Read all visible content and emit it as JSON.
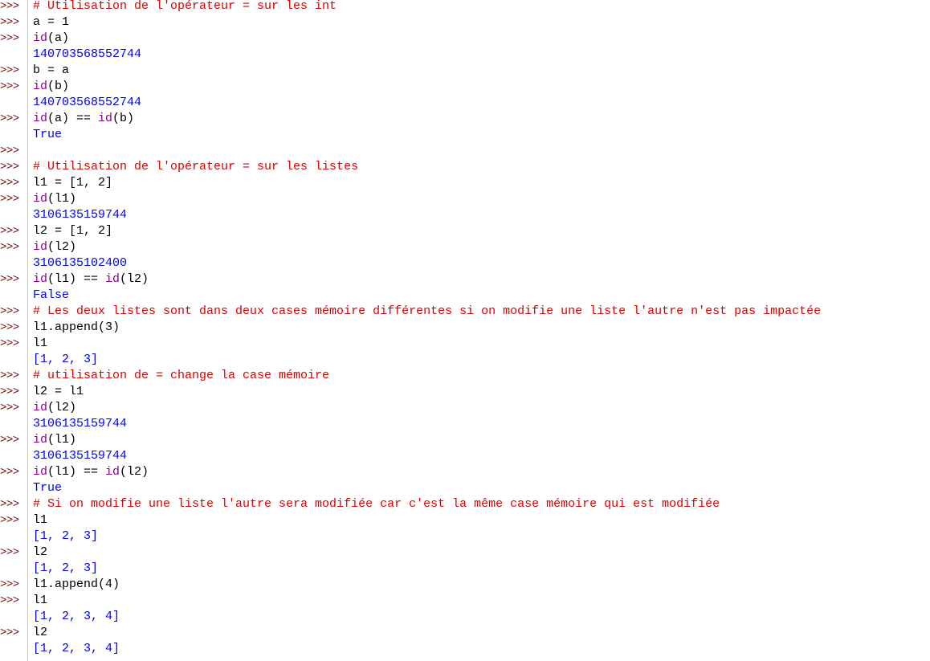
{
  "prompt_symbol": ">>>",
  "colors": {
    "plain": "#000000",
    "comment": "#dd0000",
    "builtin": "#900090",
    "output": "#0000ff",
    "prompt": "#770000"
  },
  "lines": [
    {
      "prompt": true,
      "segments": [
        {
          "t": "# Utilisation de l'opérateur = sur les int",
          "c": "comment"
        }
      ]
    },
    {
      "prompt": true,
      "segments": [
        {
          "t": "a = 1",
          "c": "plain"
        }
      ]
    },
    {
      "prompt": true,
      "segments": [
        {
          "t": "id",
          "c": "builtin"
        },
        {
          "t": "(a)",
          "c": "plain"
        }
      ]
    },
    {
      "prompt": false,
      "segments": [
        {
          "t": "140703568552744",
          "c": "output"
        }
      ]
    },
    {
      "prompt": true,
      "segments": [
        {
          "t": "b = a",
          "c": "plain"
        }
      ]
    },
    {
      "prompt": true,
      "segments": [
        {
          "t": "id",
          "c": "builtin"
        },
        {
          "t": "(b)",
          "c": "plain"
        }
      ]
    },
    {
      "prompt": false,
      "segments": [
        {
          "t": "140703568552744",
          "c": "output"
        }
      ]
    },
    {
      "prompt": true,
      "segments": [
        {
          "t": "id",
          "c": "builtin"
        },
        {
          "t": "(a) == ",
          "c": "plain"
        },
        {
          "t": "id",
          "c": "builtin"
        },
        {
          "t": "(b)",
          "c": "plain"
        }
      ]
    },
    {
      "prompt": false,
      "segments": [
        {
          "t": "True",
          "c": "output"
        }
      ]
    },
    {
      "prompt": true,
      "segments": []
    },
    {
      "prompt": true,
      "segments": [
        {
          "t": "# Utilisation de l'opérateur = sur les listes",
          "c": "comment"
        }
      ]
    },
    {
      "prompt": true,
      "segments": [
        {
          "t": "l1 = [1, 2]",
          "c": "plain"
        }
      ]
    },
    {
      "prompt": true,
      "segments": [
        {
          "t": "id",
          "c": "builtin"
        },
        {
          "t": "(l1)",
          "c": "plain"
        }
      ]
    },
    {
      "prompt": false,
      "segments": [
        {
          "t": "3106135159744",
          "c": "output"
        }
      ]
    },
    {
      "prompt": true,
      "segments": [
        {
          "t": "l2 = [1, 2]",
          "c": "plain"
        }
      ]
    },
    {
      "prompt": true,
      "segments": [
        {
          "t": "id",
          "c": "builtin"
        },
        {
          "t": "(l2)",
          "c": "plain"
        }
      ]
    },
    {
      "prompt": false,
      "segments": [
        {
          "t": "3106135102400",
          "c": "output"
        }
      ]
    },
    {
      "prompt": true,
      "segments": [
        {
          "t": "id",
          "c": "builtin"
        },
        {
          "t": "(l1) == ",
          "c": "plain"
        },
        {
          "t": "id",
          "c": "builtin"
        },
        {
          "t": "(l2)",
          "c": "plain"
        }
      ]
    },
    {
      "prompt": false,
      "segments": [
        {
          "t": "False",
          "c": "output"
        }
      ]
    },
    {
      "prompt": true,
      "segments": [
        {
          "t": "# Les deux listes sont dans deux cases mémoire différentes si on modifie une liste l'autre n'est pas impactée",
          "c": "comment"
        }
      ]
    },
    {
      "prompt": true,
      "segments": [
        {
          "t": "l1.append(3)",
          "c": "plain"
        }
      ]
    },
    {
      "prompt": true,
      "segments": [
        {
          "t": "l1",
          "c": "plain"
        }
      ]
    },
    {
      "prompt": false,
      "segments": [
        {
          "t": "[1, 2, 3]",
          "c": "output"
        }
      ]
    },
    {
      "prompt": true,
      "segments": [
        {
          "t": "# utilisation de = change la case mémoire",
          "c": "comment"
        }
      ]
    },
    {
      "prompt": true,
      "segments": [
        {
          "t": "l2 = l1",
          "c": "plain"
        }
      ]
    },
    {
      "prompt": true,
      "segments": [
        {
          "t": "id",
          "c": "builtin"
        },
        {
          "t": "(l2)",
          "c": "plain"
        }
      ]
    },
    {
      "prompt": false,
      "segments": [
        {
          "t": "3106135159744",
          "c": "output"
        }
      ]
    },
    {
      "prompt": true,
      "segments": [
        {
          "t": "id",
          "c": "builtin"
        },
        {
          "t": "(l1)",
          "c": "plain"
        }
      ]
    },
    {
      "prompt": false,
      "segments": [
        {
          "t": "3106135159744",
          "c": "output"
        }
      ]
    },
    {
      "prompt": true,
      "segments": [
        {
          "t": "id",
          "c": "builtin"
        },
        {
          "t": "(l1) == ",
          "c": "plain"
        },
        {
          "t": "id",
          "c": "builtin"
        },
        {
          "t": "(l2)",
          "c": "plain"
        }
      ]
    },
    {
      "prompt": false,
      "segments": [
        {
          "t": "True",
          "c": "output"
        }
      ]
    },
    {
      "prompt": true,
      "segments": [
        {
          "t": "# Si on modifie une liste l'autre sera modifiée car c'est la même case mémoire qui est modifiée",
          "c": "comment"
        }
      ]
    },
    {
      "prompt": true,
      "segments": [
        {
          "t": "l1",
          "c": "plain"
        }
      ]
    },
    {
      "prompt": false,
      "segments": [
        {
          "t": "[1, 2, 3]",
          "c": "output"
        }
      ]
    },
    {
      "prompt": true,
      "segments": [
        {
          "t": "l2",
          "c": "plain"
        }
      ]
    },
    {
      "prompt": false,
      "segments": [
        {
          "t": "[1, 2, 3]",
          "c": "output"
        }
      ]
    },
    {
      "prompt": true,
      "segments": [
        {
          "t": "l1.append(4)",
          "c": "plain"
        }
      ]
    },
    {
      "prompt": true,
      "segments": [
        {
          "t": "l1",
          "c": "plain"
        }
      ]
    },
    {
      "prompt": false,
      "segments": [
        {
          "t": "[1, 2, 3, 4]",
          "c": "output"
        }
      ]
    },
    {
      "prompt": true,
      "segments": [
        {
          "t": "l2",
          "c": "plain"
        }
      ]
    },
    {
      "prompt": false,
      "segments": [
        {
          "t": "[1, 2, 3, 4]",
          "c": "output"
        }
      ]
    }
  ]
}
